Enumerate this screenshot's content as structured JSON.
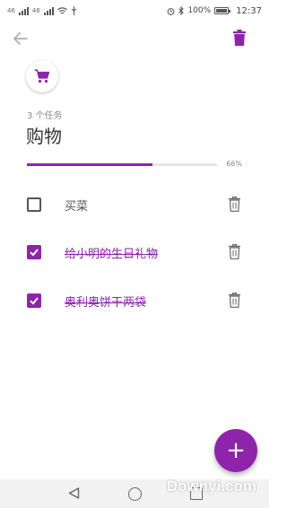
{
  "theme": {
    "accent": "#8e24aa",
    "text": "#333333",
    "muted": "#8a8a8a"
  },
  "status_bar": {
    "signal_left": "46",
    "signal_right": "46",
    "battery": "100%",
    "time": "12:37"
  },
  "toolbar": {
    "back_icon": "arrow-left-icon",
    "delete_icon": "trash-icon"
  },
  "category": {
    "icon": "shopping-cart-icon"
  },
  "list": {
    "task_count": "3 个任务",
    "title": "购物",
    "progress": 0.66,
    "progress_label": "66%"
  },
  "tasks": [
    {
      "label": "买菜",
      "done": false
    },
    {
      "label": "给小明的生日礼物",
      "done": true
    },
    {
      "label": "奥利奥饼干两袋",
      "done": true
    }
  ],
  "fab": {
    "label": "+"
  },
  "watermark": "Downyi.com"
}
